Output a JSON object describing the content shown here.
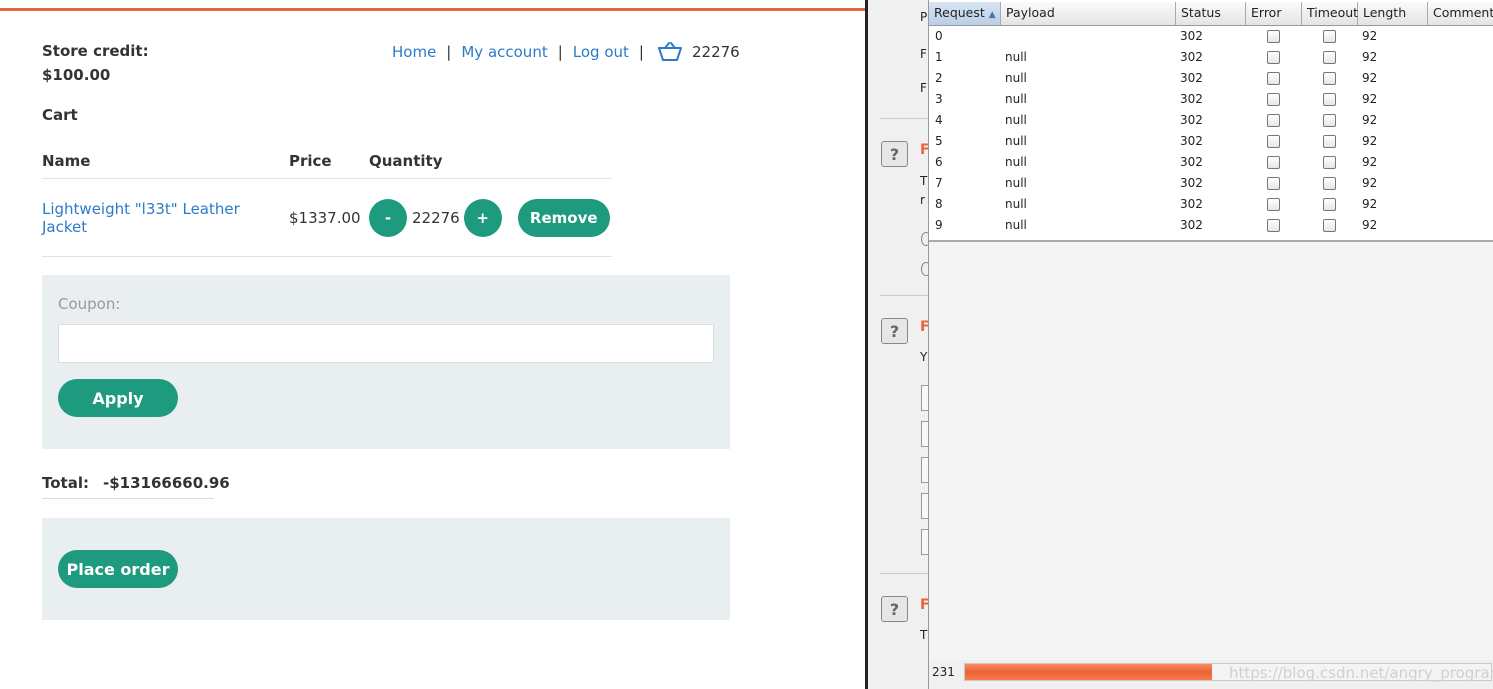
{
  "shop": {
    "store_credit_label": "Store credit:",
    "store_credit_value": "$100.00",
    "nav": {
      "home": "Home",
      "my_account": "My account",
      "log_out": "Log out",
      "separator": "|",
      "cart_count": "22276"
    },
    "cart_title": "Cart",
    "columns": {
      "name": "Name",
      "price": "Price",
      "quantity": "Quantity"
    },
    "item": {
      "name": "Lightweight \"l33t\" Leather Jacket",
      "price": "$1337.00",
      "quantity": "22276",
      "minus": "-",
      "plus": "+",
      "remove": "Remove"
    },
    "coupon": {
      "label": "Coupon:",
      "placeholder": "",
      "apply": "Apply"
    },
    "total": {
      "label": "Total:",
      "value": "-$13166660.96"
    },
    "place_order": "Place order",
    "accent_color": "#1e9a7e",
    "brand_color": "#e8643a"
  },
  "burp": {
    "columns": {
      "request": "Request",
      "payload": "Payload",
      "status": "Status",
      "error": "Error",
      "timeout": "Timeout",
      "length": "Length",
      "comment": "Comment"
    },
    "rows": [
      {
        "request": "0",
        "payload": "",
        "status": "302",
        "length": "92"
      },
      {
        "request": "1",
        "payload": "null",
        "status": "302",
        "length": "92"
      },
      {
        "request": "2",
        "payload": "null",
        "status": "302",
        "length": "92"
      },
      {
        "request": "3",
        "payload": "null",
        "status": "302",
        "length": "92"
      },
      {
        "request": "4",
        "payload": "null",
        "status": "302",
        "length": "92"
      },
      {
        "request": "5",
        "payload": "null",
        "status": "302",
        "length": "92"
      },
      {
        "request": "6",
        "payload": "null",
        "status": "302",
        "length": "92"
      },
      {
        "request": "7",
        "payload": "null",
        "status": "302",
        "length": "92"
      },
      {
        "request": "8",
        "payload": "null",
        "status": "302",
        "length": "92"
      },
      {
        "request": "9",
        "payload": "null",
        "status": "302",
        "length": "92"
      }
    ],
    "progress_count": "231",
    "progress_fraction": 0.47,
    "watermark": "https://blog.csdn.net/angry_program",
    "side_peek": [
      "P",
      "F",
      "F",
      "F",
      "T",
      "r",
      "F",
      "Y",
      "F",
      "T"
    ]
  }
}
